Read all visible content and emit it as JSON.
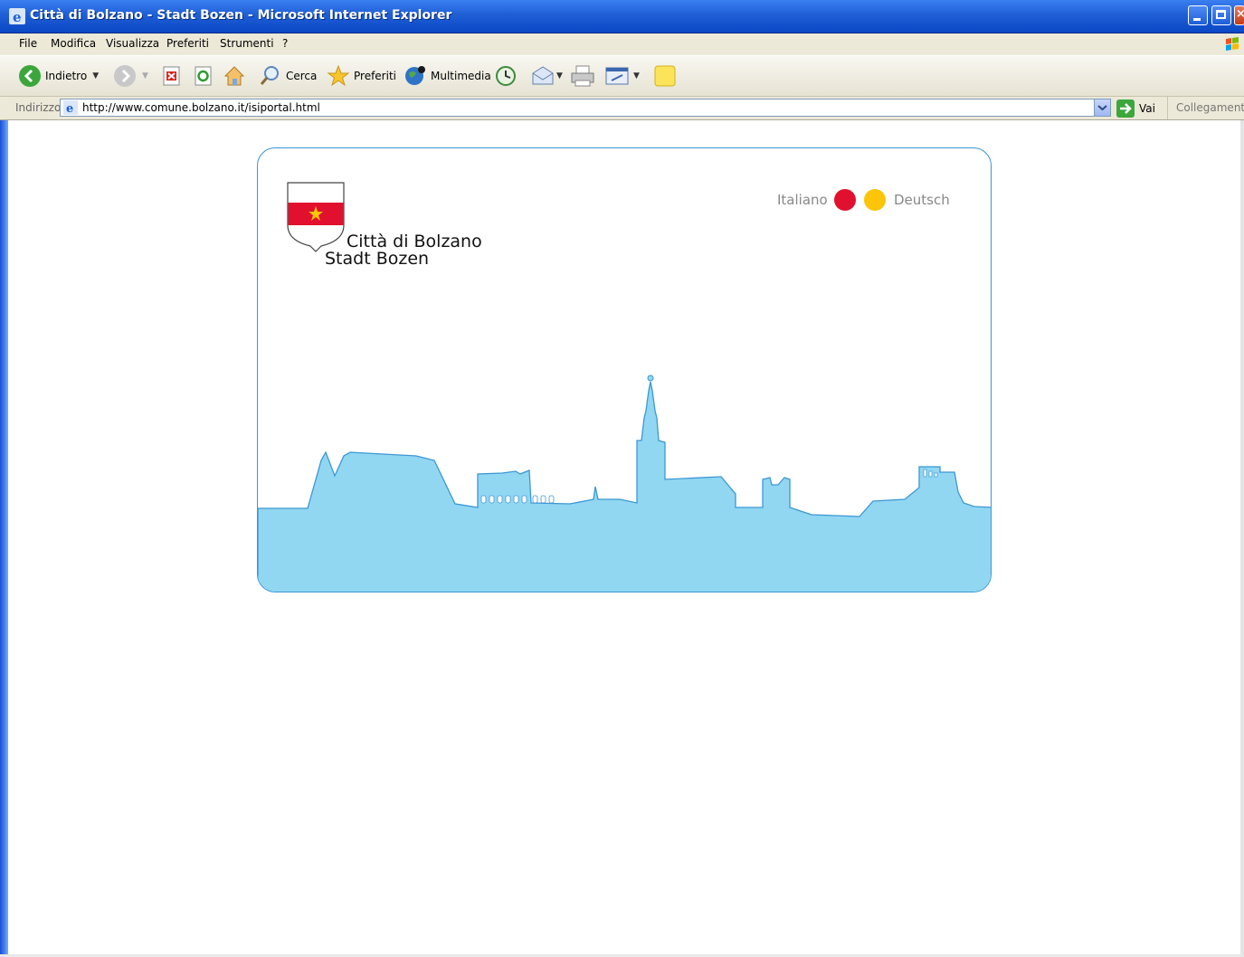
{
  "window": {
    "title": "Città di Bolzano - Stadt Bozen - Microsoft Internet Explorer"
  },
  "menu": {
    "items": [
      "File",
      "Modifica",
      "Visualizza",
      "Preferiti",
      "Strumenti",
      "?"
    ]
  },
  "toolbar": {
    "back_label": "Indietro",
    "search_label": "Cerca",
    "favorites_label": "Preferiti",
    "media_label": "Multimedia"
  },
  "address": {
    "label": "Indirizzo",
    "url": "http://www.comune.bolzano.it/isiportal.html",
    "go_label": "Vai",
    "links_label": "Collegamenti"
  },
  "page": {
    "city_italian": "Città di Bolzano",
    "city_german": "Stadt Bozen",
    "lang_italian": "Italiano",
    "lang_german": "Deutsch",
    "colors": {
      "italian_dot": "#e0102e",
      "german_dot": "#fdc50a",
      "skyline_fill": "#91d7f2",
      "skyline_stroke": "#3b97d3",
      "shield_red": "#e0102e",
      "star_yellow": "#fdc50a"
    }
  }
}
